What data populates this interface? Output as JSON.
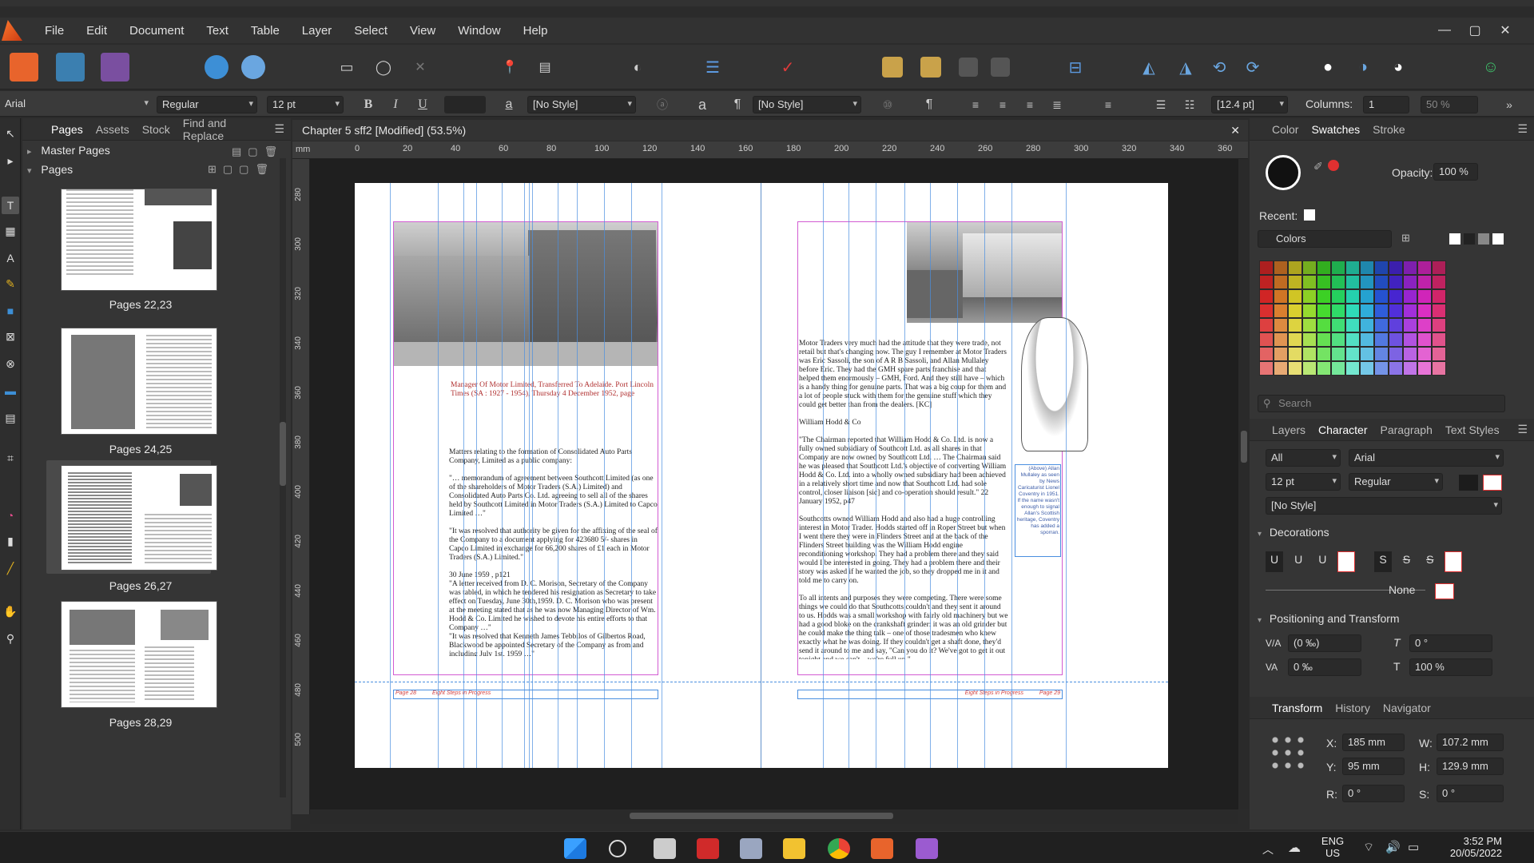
{
  "menu": {
    "items": [
      "File",
      "Edit",
      "Document",
      "Text",
      "Table",
      "Layer",
      "Select",
      "View",
      "Window",
      "Help"
    ]
  },
  "window_controls": {
    "minimize": "—",
    "maximize": "▢",
    "close": "✕"
  },
  "context_toolbar": {
    "font_family": "Arial",
    "font_style": "Regular",
    "font_size": "12 pt",
    "bold": "B",
    "italic": "I",
    "underline": "U",
    "char_style_icon": "a",
    "char_style": "[No Style]",
    "para_style_icon": "¶",
    "para_style": "[No Style]",
    "leading": "[12.4 pt]",
    "columns_label": "Columns:",
    "columns_value": "1",
    "percent_value": "50 %"
  },
  "left_panel": {
    "tabs": [
      "Pages",
      "Assets",
      "Stock",
      "Find and Replace"
    ],
    "master_pages_label": "Master Pages",
    "pages_label": "Pages",
    "thumbnails": [
      {
        "caption": "Pages 22,23"
      },
      {
        "caption": "Pages 24,25"
      },
      {
        "caption": "Pages 26,27"
      },
      {
        "caption": "Pages 28,29"
      }
    ]
  },
  "document": {
    "title": "Chapter 5 sff2 [Modified] (53.5%)",
    "ruler_unit": "mm",
    "ruler_h_ticks": [
      "0",
      "20",
      "40",
      "60",
      "80",
      "100",
      "120",
      "140",
      "160",
      "180",
      "200",
      "220",
      "240",
      "260",
      "280",
      "300",
      "320",
      "340",
      "360"
    ],
    "ruler_v_ticks": [
      "280",
      "300",
      "320",
      "340",
      "360",
      "380",
      "400",
      "420",
      "440",
      "460",
      "480",
      "500"
    ],
    "left_page": {
      "footer_left": "Page 28",
      "footer_title": "Eight Steps in Progress",
      "para1": "Matters relating to the formation of Consolidated Auto Parts Company, Limited as a public company:",
      "para2": "\"… memorandum of agreement between Southcott Limited (as one of the shareholders of Motor Traders (S.A.) Limited) and Consolidated Auto Parts Co. Ltd. agreeing to sell all of the shares held by Southcott Limited in Motor Traders (S.A.) Limited to Capco Limited …\"",
      "para3": "\"It was resolved that authority be given for the affixing of the seal of the Company to a document applying for 423680 5/- shares in Capco Limited in exchange for 66,200 shares of £1 each in Motor Traders (S.A.) Limited.\"",
      "para4": "30 June 1959 , p121",
      "para5": "\"A letter received from D. C. Morison, Secretary of the Company was tabled, in which he tendered his resignation as Secretary to take effect on Tuesday, June 30th,1959. D. C. Morison who was present at the meeting stated that as he was now Managing Director of Wm. Hodd & Co. Limited he wished to devote his entire efforts to that Company …\"",
      "para6": "\"It was resolved that Kenneth James Tebbilos of Gilbertos Road, Blackwood be appointed Secretary of the Company as from and including July 1st, 1959 …\"",
      "overlap_caption": "Manager Of Motor Limited, Transferred To Adelaide. Port Lincoln Times (SA : 1927 - 1954), Thursday 4 December 1952, page"
    },
    "right_page": {
      "footer_title": "Eight Steps in Progress",
      "footer_right": "Page 29",
      "para1": "Motor Traders very much had the attitude that they were trade, not retail but that's changing now. The guy I remember at Motor Traders was Eric Sassoli, the son of A R B Sassoli, and Allan Mullaley before Eric. They had the GMH spare parts franchise and that helped them enormously – GMH, Ford. And they still have – which is a handy thing for genuine parts. That was a big coup for them and a lot of people stuck with them for the genuine stuff which they could get better than from the dealers. [KC]",
      "para2": "William Hodd & Co",
      "para3": "\"The Chairman reported that William Hodd & Co. Ltd. is now a fully owned subsidiary of Southcott Ltd. as all shares in that Company are now owned by Southcott Ltd. … The Chairman said he was pleased that Southcott Ltd.'s objective of converting William Hodd & Co. Ltd. into a wholly owned subsidiary had been achieved in a relatively short time and now that Southcott Ltd. had sole control, closer liaison [sic] and co-operation should result.\" 22 January 1952, p47",
      "para4": "Southcotts owned William Hodd and also had a huge controlling interest in Motor Trader. Hodds started off in Roper Street but when I went there they were in Flinders Street and at the back of the Flinders Street building was the William Hodd engine reconditioning workshop. They had a problem there and they said would I be interested in going. They had a problem there and their story was asked if he wanted the job, so they dropped me in it and told me to carry on.",
      "para5": "To all intents and purposes they were competing. There were some things we could do that Southcotts couldn't and they sent it around to us. Hodds was a small workshop with fairly old machinery but we had a good bloke on the crankshaft grinder: it was an old grinder but he could make the thing talk – one of those tradesmen who knew exactly what he was doing. If they couldn't get a shaft done, they'd send it around to me and say, \"Can you do it? We've got to get it out tonight and we can't – we're full up.\"",
      "caption": "(Above) Allan Mullaley as seen by News Caricaturist Lionel Coventry in 1951. If the name wasn't enough to signal Allan's Scottish heritage, Coventry has added a sporran."
    }
  },
  "right_panel": {
    "top_tabs": [
      "Color",
      "Swatches",
      "Stroke"
    ],
    "opacity_label": "Opacity:",
    "opacity_value": "100 %",
    "recent_label": "Recent:",
    "palette_label": "Colors",
    "search_placeholder": "Search",
    "mid_tabs": [
      "Layers",
      "Character",
      "Paragraph",
      "Text Styles"
    ],
    "char_scope": "All",
    "char_font": "Arial",
    "char_size": "12 pt",
    "char_weight": "Regular",
    "char_style": "[No Style]",
    "decorations_label": "Decorations",
    "deco_none": "None",
    "positioning_label": "Positioning and Transform",
    "tracking": "(0 ‰)",
    "shear": "0 °",
    "baseline": "0 ‰",
    "scale": "100 %",
    "bottom_tabs": [
      "Transform",
      "History",
      "Navigator"
    ],
    "x_label": "X:",
    "x_value": "185 mm",
    "y_label": "Y:",
    "y_value": "95 mm",
    "w_label": "W:",
    "w_value": "107.2 mm",
    "h_label": "H:",
    "h_value": "129.9 mm",
    "r_label": "R:",
    "r_value": "0 °",
    "s_label": "S:",
    "s_value": "0 °"
  },
  "taskbar": {
    "language": "ENG",
    "region": "US",
    "time": "3:52 PM",
    "date": "20/05/2022"
  },
  "colors": {
    "accent_orange": "#e8642c",
    "guide_blue": "#4a8fe0",
    "margin_magenta": "#d25cd2",
    "panel_bg": "#353535"
  }
}
